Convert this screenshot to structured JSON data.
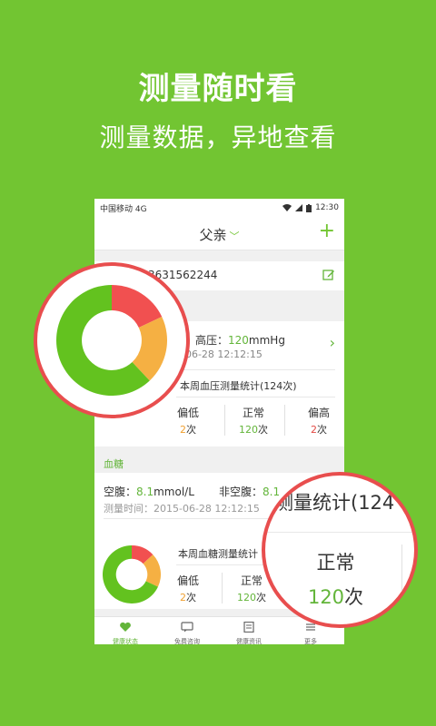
{
  "hero": {
    "title": "测量随时看",
    "subtitle": "测量数据，异地查看"
  },
  "status": {
    "carrier": "中国移动 4G",
    "time": "12:30"
  },
  "nav": {
    "title": "父亲",
    "caret": "﹀",
    "add": "+"
  },
  "user": {
    "phone": "3631562244"
  },
  "blood_pressure": {
    "high_label": "高压：",
    "high_value": "120",
    "high_unit": "mmHg",
    "time_fragment": "-06-28  12:12:15",
    "stat_title": "本周血压测量统计(124次)",
    "stats": [
      {
        "label": "偏低",
        "count": "2",
        "unit": "次",
        "color": "#f0a030"
      },
      {
        "label": "正常",
        "count": "120",
        "unit": "次",
        "color": "#63b53a"
      },
      {
        "label": "偏高",
        "count": "2",
        "unit": "次",
        "color": "#e24a44"
      }
    ],
    "donut": [
      {
        "value": 0.62,
        "color": "#63c21f"
      },
      {
        "value": 0.18,
        "color": "#f15050"
      },
      {
        "value": 0.2,
        "color": "#f5b043"
      }
    ]
  },
  "blood_sugar": {
    "section": "血糖",
    "fasting_label": "空腹：",
    "fasting_value": "8.1",
    "fasting_unit": "mmol/L",
    "nonfasting_label": "非空腹：",
    "nonfasting_value": "8.1",
    "time_label": "测量时间：2015-06-28  12:12:15",
    "stat_title": "本周血糖测量统计",
    "stats": [
      {
        "label": "偏低",
        "count": "2",
        "unit": "次",
        "color": "#f0a030"
      },
      {
        "label": "正常",
        "count": "120",
        "unit": "次",
        "color": "#63b53a"
      }
    ],
    "donut": [
      {
        "value": 0.68,
        "color": "#63c21f"
      },
      {
        "value": 0.13,
        "color": "#f15050"
      },
      {
        "value": 0.19,
        "color": "#f5b043"
      }
    ]
  },
  "tabs": [
    {
      "label": "健康状态",
      "icon": "heart-icon",
      "active": true
    },
    {
      "label": "免费咨询",
      "icon": "chat-icon",
      "active": false
    },
    {
      "label": "健康资讯",
      "icon": "news-icon",
      "active": false
    },
    {
      "label": "更多",
      "icon": "more-icon",
      "active": false
    }
  ],
  "magnifier_right": {
    "title": "测量统计(124",
    "label": "正常",
    "count": "120",
    "unit": "次"
  },
  "colors": {
    "brand_green": "#72c532",
    "accent_green": "#63b53a",
    "magnifier_border": "#e84e4e"
  }
}
